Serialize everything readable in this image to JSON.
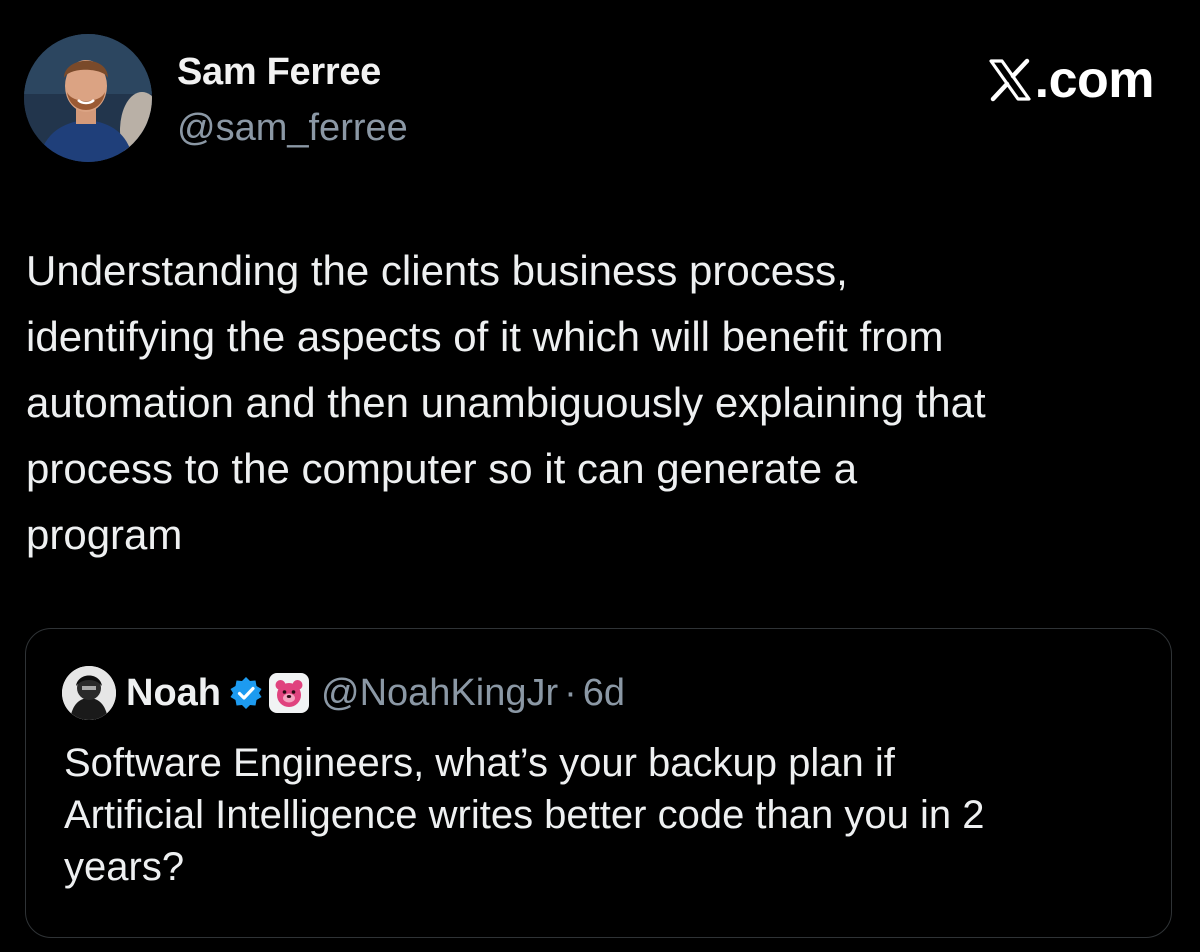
{
  "brand": {
    "text": ".com",
    "icon": "x-logo-icon"
  },
  "author": {
    "name": "Sam Ferree",
    "handle": "@sam_ferree",
    "avatar_icon": "avatar-photo"
  },
  "tweet": {
    "text": "Understanding the clients business process,\nidentifying the aspects of it which will benefit from\nautomation and then unambiguously explaining that\nprocess to the computer so it can generate a\nprogram"
  },
  "quoted": {
    "name": "Noah",
    "handle": "@NoahKingJr",
    "separator": "·",
    "time": "6d",
    "text": "Software Engineers, what’s your backup plan if\nArtificial Intelligence writes better code than you in 2\nyears?",
    "verified_icon": "verified-badge-icon",
    "affiliate_icon": "bear-affiliate-icon"
  },
  "colors": {
    "background": "#000000",
    "text": "#e7e9ea",
    "muted": "#8b98a5",
    "border": "#2f3336",
    "verified": "#1d9bf0",
    "affiliate_accent": "#e0427e"
  }
}
